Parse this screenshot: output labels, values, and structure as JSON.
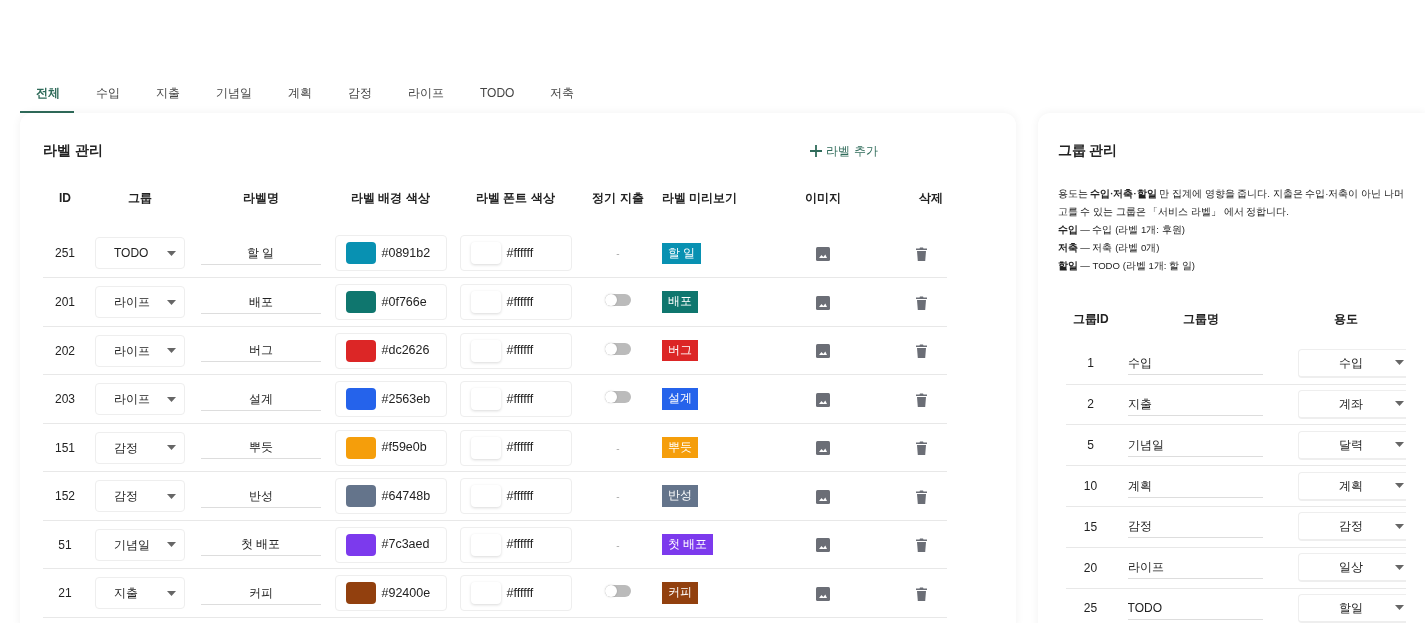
{
  "tabs": [
    {
      "label": "전체",
      "selected": true
    },
    {
      "label": "수입",
      "selected": false
    },
    {
      "label": "지출",
      "selected": false
    },
    {
      "label": "기념일",
      "selected": false
    },
    {
      "label": "계획",
      "selected": false
    },
    {
      "label": "감정",
      "selected": false
    },
    {
      "label": "라이프",
      "selected": false
    },
    {
      "label": "TODO",
      "selected": false
    },
    {
      "label": "저축",
      "selected": false
    }
  ],
  "label_panel": {
    "title": "라벨 관리",
    "add_button": "라벨 추가",
    "columns": [
      "ID",
      "그룹",
      "라벨명",
      "라벨 배경 색상",
      "라벨 폰트 색상",
      "정기 지출",
      "라벨 미리보기",
      "이미지",
      "삭제"
    ],
    "rows": [
      {
        "id": "251",
        "group": "TODO",
        "name": "할 일",
        "color": "#0891b2",
        "font_color": "#ffffff",
        "recurring": {
          "kind": "dash",
          "text": "-"
        },
        "preview": "할 일"
      },
      {
        "id": "201",
        "group": "라이프",
        "name": "배포",
        "color": "#0f766e",
        "font_color": "#ffffff",
        "recurring": {
          "kind": "switch",
          "on": false
        },
        "preview": "배포"
      },
      {
        "id": "202",
        "group": "라이프",
        "name": "버그",
        "color": "#dc2626",
        "font_color": "#ffffff",
        "recurring": {
          "kind": "switch",
          "on": false
        },
        "preview": "버그"
      },
      {
        "id": "203",
        "group": "라이프",
        "name": "설계",
        "color": "#2563eb",
        "font_color": "#ffffff",
        "recurring": {
          "kind": "switch",
          "on": false
        },
        "preview": "설계"
      },
      {
        "id": "151",
        "group": "감정",
        "name": "뿌듯",
        "color": "#f59e0b",
        "font_color": "#ffffff",
        "recurring": {
          "kind": "dash",
          "text": "-"
        },
        "preview": "뿌듯"
      },
      {
        "id": "152",
        "group": "감정",
        "name": "반성",
        "color": "#64748b",
        "font_color": "#ffffff",
        "recurring": {
          "kind": "dash",
          "text": "-"
        },
        "preview": "반성"
      },
      {
        "id": "51",
        "group": "기념일",
        "name": "첫 배포",
        "color": "#7c3aed",
        "font_color": "#ffffff",
        "recurring": {
          "kind": "dash",
          "text": "-"
        },
        "preview": "첫 배포"
      },
      {
        "id": "21",
        "group": "지출",
        "name": "커피",
        "color": "#92400e",
        "font_color": "#ffffff",
        "recurring": {
          "kind": "switch",
          "on": false
        },
        "preview": "커피"
      }
    ]
  },
  "group_panel": {
    "title": "그룹 관리",
    "notes": [
      "용도는 **수입·저축·할일** 만 집계에 영향을 줍니다. 지출은 수입·저축이 아닌 나머",
      "고를 수 있는 그룹은 「서비스 라벨」 에서 정합니다.",
      "**수입** — 수입 (라벨 1개: 후원)",
      "**저축** — 저축 (라벨 0개)",
      "**할일** — TODO (라벨 1개: 할 일)"
    ],
    "columns": [
      "그룹ID",
      "그룹명",
      "용도"
    ],
    "rows": [
      {
        "id": "1",
        "name": "수입",
        "usage": "수입"
      },
      {
        "id": "2",
        "name": "지출",
        "usage": "계좌"
      },
      {
        "id": "5",
        "name": "기념일",
        "usage": "달력"
      },
      {
        "id": "10",
        "name": "계획",
        "usage": "계획"
      },
      {
        "id": "15",
        "name": "감정",
        "usage": "감정"
      },
      {
        "id": "20",
        "name": "라이프",
        "usage": "일상"
      },
      {
        "id": "25",
        "name": "TODO",
        "usage": "할일"
      }
    ]
  }
}
